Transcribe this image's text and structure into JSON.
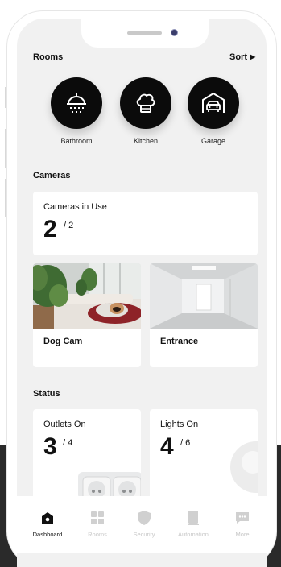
{
  "rooms_section": {
    "title": "Rooms",
    "sort_label": "Sort",
    "items": [
      {
        "label": "Bathroom",
        "icon": "shower-icon"
      },
      {
        "label": "Kitchen",
        "icon": "chef-hat-icon"
      },
      {
        "label": "Garage",
        "icon": "garage-icon"
      }
    ]
  },
  "cameras_section": {
    "title": "Cameras",
    "in_use_title": "Cameras in Use",
    "in_use_count": "2",
    "in_use_total": "/ 2",
    "feeds": [
      {
        "label": "Dog Cam"
      },
      {
        "label": "Entrance"
      }
    ]
  },
  "status_section": {
    "title": "Status",
    "outlets_title": "Outlets On",
    "outlets_count": "3",
    "outlets_total": "/ 4",
    "lights_title": "Lights On",
    "lights_count": "4",
    "lights_total": "/ 6"
  },
  "tabbar": {
    "items": [
      {
        "label": "Dashboard",
        "icon": "home-icon",
        "active": true
      },
      {
        "label": "Rooms",
        "icon": "grid-icon",
        "active": false
      },
      {
        "label": "Security",
        "icon": "shield-icon",
        "active": false
      },
      {
        "label": "Automation",
        "icon": "device-icon",
        "active": false
      },
      {
        "label": "More",
        "icon": "chat-icon",
        "active": false
      }
    ]
  },
  "colors": {
    "accent": "#0b0b0b",
    "screen_background": "#f1f1f1",
    "card_background": "#ffffff",
    "inactive_tab": "#c8c8c8"
  }
}
